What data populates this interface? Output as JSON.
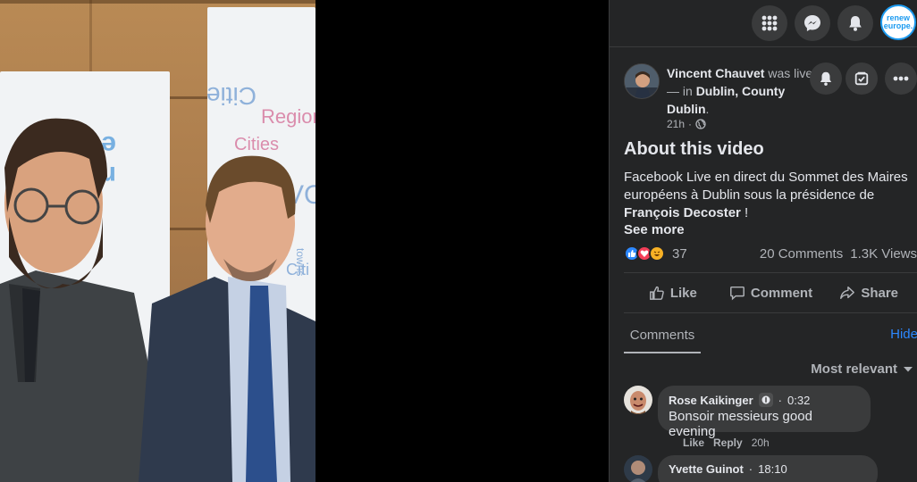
{
  "colors": {
    "panel_bg": "#242526",
    "control_bg": "#3a3b3c",
    "link": "#2d88ff",
    "brand": "#1d9bf0"
  },
  "topbar": {
    "icons": [
      "menu-grid-icon",
      "messenger-icon",
      "notifications-bell-icon"
    ],
    "brand_avatar": {
      "line1": "renew",
      "line2": "europe."
    }
  },
  "post": {
    "author": "Vincent Chauvet",
    "status": " was live — in ",
    "location": "Dublin, County Dublin",
    "period": ".",
    "time": "21h",
    "visibility_icon": "globe-icon"
  },
  "about": {
    "title": "About this video",
    "text_part1": "Facebook Live en direct du Sommet des Maires européens à Dublin sous la présidence de ",
    "text_bold": "François Decoster",
    "text_part2": " !",
    "see_more": "See more"
  },
  "reactions": {
    "types": [
      "like",
      "love",
      "haha"
    ],
    "count": "37",
    "comments": "20 Comments",
    "views": "1.3K Views"
  },
  "actions": {
    "like": "Like",
    "comment": "Comment",
    "share": "Share"
  },
  "tabs": {
    "comments": "Comments",
    "hide": "Hide"
  },
  "sort": {
    "label": "Most relevant"
  },
  "comments": [
    {
      "name": "Rose Kaikinger",
      "separator": "·",
      "timestamp": "0:32",
      "text": "Bonsoir messieurs good evening",
      "like": "Like",
      "reply": "Reply",
      "age": "20h"
    },
    {
      "name": "Yvette Guinot",
      "separator": "·",
      "timestamp": "18:10"
    }
  ]
}
